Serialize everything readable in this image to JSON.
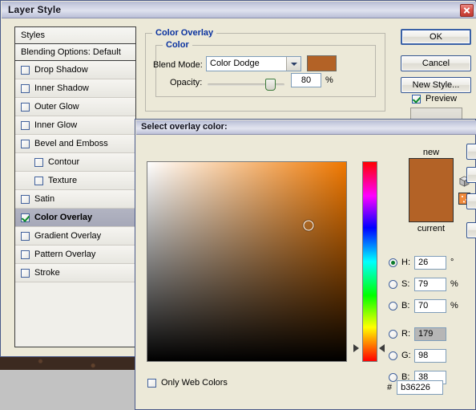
{
  "window": {
    "title": "Layer Style",
    "close_icon": "close-icon"
  },
  "styles_panel": {
    "header": "Styles",
    "blending_options": "Blending Options: Default",
    "effects": [
      {
        "label": "Drop Shadow",
        "checked": false,
        "indent": false
      },
      {
        "label": "Inner Shadow",
        "checked": false,
        "indent": false
      },
      {
        "label": "Outer Glow",
        "checked": false,
        "indent": false
      },
      {
        "label": "Inner Glow",
        "checked": false,
        "indent": false
      },
      {
        "label": "Bevel and Emboss",
        "checked": false,
        "indent": false
      },
      {
        "label": "Contour",
        "checked": false,
        "indent": true
      },
      {
        "label": "Texture",
        "checked": false,
        "indent": true
      },
      {
        "label": "Satin",
        "checked": false,
        "indent": false
      },
      {
        "label": "Color Overlay",
        "checked": true,
        "indent": false,
        "selected": true
      },
      {
        "label": "Gradient Overlay",
        "checked": false,
        "indent": false
      },
      {
        "label": "Pattern Overlay",
        "checked": false,
        "indent": false
      },
      {
        "label": "Stroke",
        "checked": false,
        "indent": false
      }
    ]
  },
  "buttons": {
    "ok": "OK",
    "cancel": "Cancel",
    "new_style": "New Style...",
    "preview_label": "Preview",
    "preview_checked": true
  },
  "color_overlay": {
    "group_title": "Color Overlay",
    "color_group_title": "Color",
    "blend_mode_label": "Blend Mode:",
    "blend_mode_value": "Color Dodge",
    "blend_swatch_color": "#b36226",
    "opacity_label": "Opacity:",
    "opacity_value": "80",
    "opacity_unit": "%",
    "opacity_percent": 80
  },
  "picker": {
    "title": "Select overlay color:",
    "new_label": "new",
    "current_label": "current",
    "new_color": "#b36226",
    "current_color": "#b36226",
    "field_hue_color": "#f07800",
    "marker_x_percent": 81,
    "marker_y_percent": 32,
    "hue_arrow_percent": 93,
    "gamut_icon": "cube-icon",
    "websafe_icon": "web-safe-swatch-icon",
    "fields": [
      {
        "name": "hue",
        "label": "H:",
        "value": "26",
        "unit": "°",
        "selected_radio": true,
        "highlighted": false
      },
      {
        "name": "saturation",
        "label": "S:",
        "value": "79",
        "unit": "%",
        "selected_radio": false,
        "highlighted": false
      },
      {
        "name": "brightness",
        "label": "B:",
        "value": "70",
        "unit": "%",
        "selected_radio": false,
        "highlighted": false
      },
      {
        "name": "red",
        "label": "R:",
        "value": "179",
        "unit": "",
        "selected_radio": false,
        "highlighted": true
      },
      {
        "name": "green",
        "label": "G:",
        "value": "98",
        "unit": "",
        "selected_radio": false,
        "highlighted": false
      },
      {
        "name": "blue",
        "label": "B:",
        "value": "38",
        "unit": "",
        "selected_radio": false,
        "highlighted": false
      }
    ],
    "hex_label": "#",
    "hex_value": "b36226",
    "only_web_colors_label": "Only Web Colors",
    "only_web_colors_checked": false
  }
}
